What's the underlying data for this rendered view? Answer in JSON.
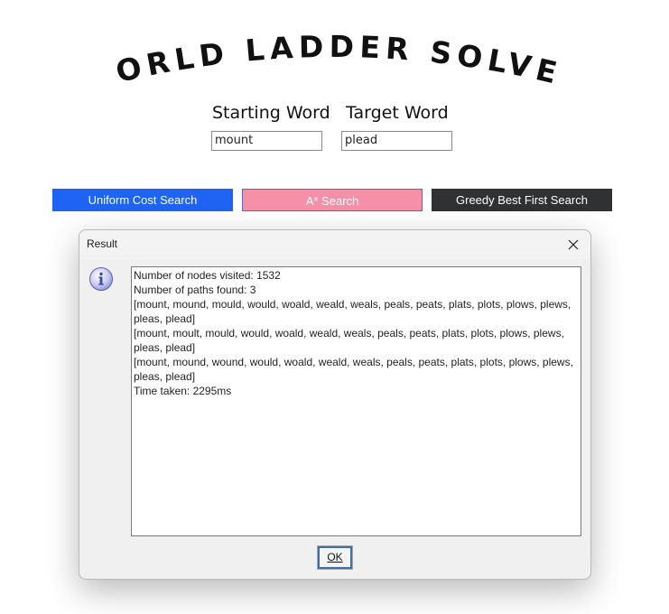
{
  "app": {
    "title": "WORLD LADDER SOLVER"
  },
  "form": {
    "start_label": "Starting Word",
    "start_value": "mount",
    "target_label": "Target Word",
    "target_value": "plead"
  },
  "buttons": {
    "ucs_label": "Uniform Cost Search",
    "astar_label": "A* Search",
    "greedy_label": "Greedy Best First Search"
  },
  "dialog": {
    "title": "Result",
    "close_icon": "close-icon",
    "info_icon": "info-icon",
    "result_text": "Number of nodes visited: 1532\nNumber of paths found: 3\n[mount, mound, mould, would, woald, weald, weals, peals, peats, plats, plots, plows, plews, pleas, plead]\n[mount, moult, mould, would, woald, weald, weals, peals, peats, plats, plots, plows, plews, pleas, plead]\n[mount, mound, wound, would, woald, weald, weals, peals, peats, plats, plots, plows, plews, pleas, plead]\nTime taken: 2295ms",
    "ok_label": "OK"
  },
  "colors": {
    "ucs": "#1f63f2",
    "astar": "#f68fa8",
    "greedy": "#2f3133"
  }
}
